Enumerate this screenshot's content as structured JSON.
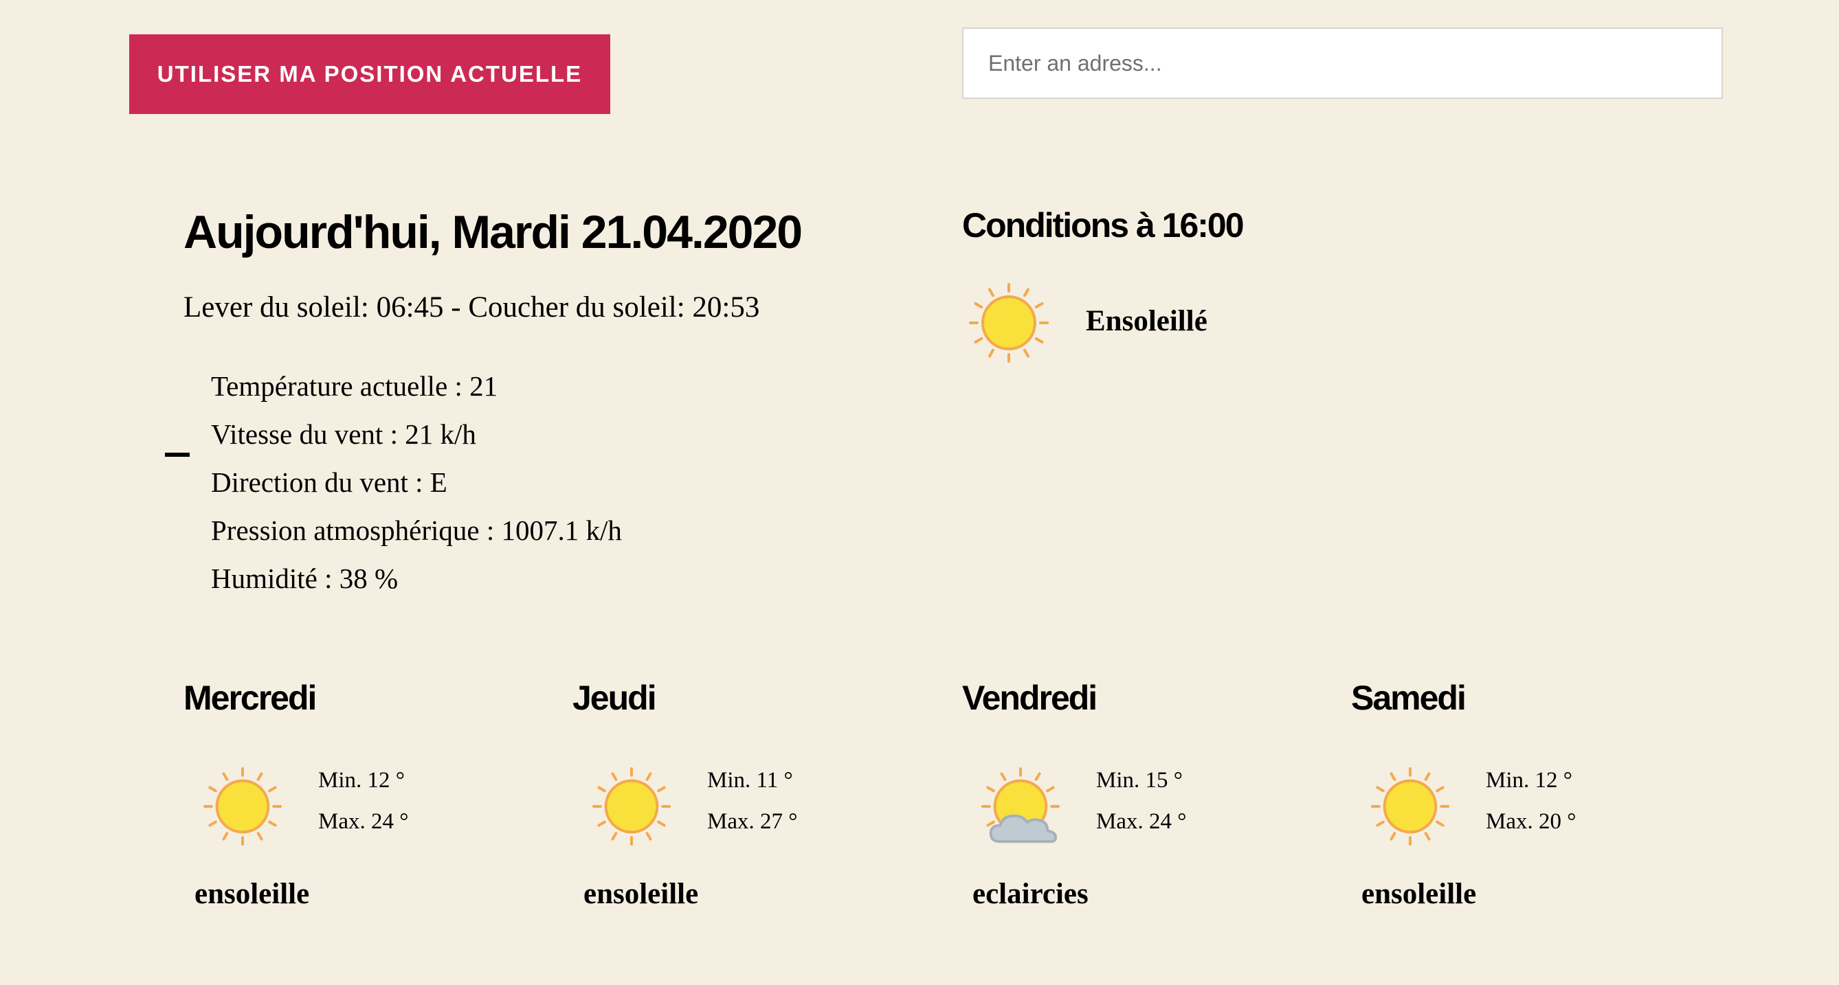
{
  "location_button": {
    "label": "UTILISER MA POSITION ACTUELLE"
  },
  "address_search": {
    "placeholder": "Enter an adress...",
    "value": ""
  },
  "today": {
    "title": "Aujourd'hui, Mardi 21.04.2020",
    "sun_times": "Lever du soleil: 06:45 - Coucher du soleil: 20:53",
    "details": [
      "Température actuelle : 21",
      "Vitesse du vent : 21 k/h",
      "Direction du vent : E",
      "Pression atmosphérique : 1007.1 k/h",
      "Humidité : 38 %"
    ]
  },
  "current_conditions": {
    "title": "Conditions à 16:00",
    "icon": "sun-icon",
    "description": "Ensoleillé"
  },
  "forecast": [
    {
      "day": "Mercredi",
      "icon": "sun-icon",
      "min": "Min. 12 °",
      "max": "Max. 24 °",
      "description": "ensoleille"
    },
    {
      "day": "Jeudi",
      "icon": "sun-icon",
      "min": "Min. 11 °",
      "max": "Max. 27 °",
      "description": "ensoleille"
    },
    {
      "day": "Vendredi",
      "icon": "sun-cloud-icon",
      "min": "Min. 15 °",
      "max": "Max. 24 °",
      "description": "eclaircies"
    },
    {
      "day": "Samedi",
      "icon": "sun-icon",
      "min": "Min. 12 °",
      "max": "Max. 20 °",
      "description": "ensoleille"
    }
  ],
  "colors": {
    "background": "#f4efe1",
    "button": "#cc2a54",
    "sun_fill": "#f9e03a",
    "sun_stroke": "#f4a94d",
    "cloud": "#c0cad3"
  }
}
